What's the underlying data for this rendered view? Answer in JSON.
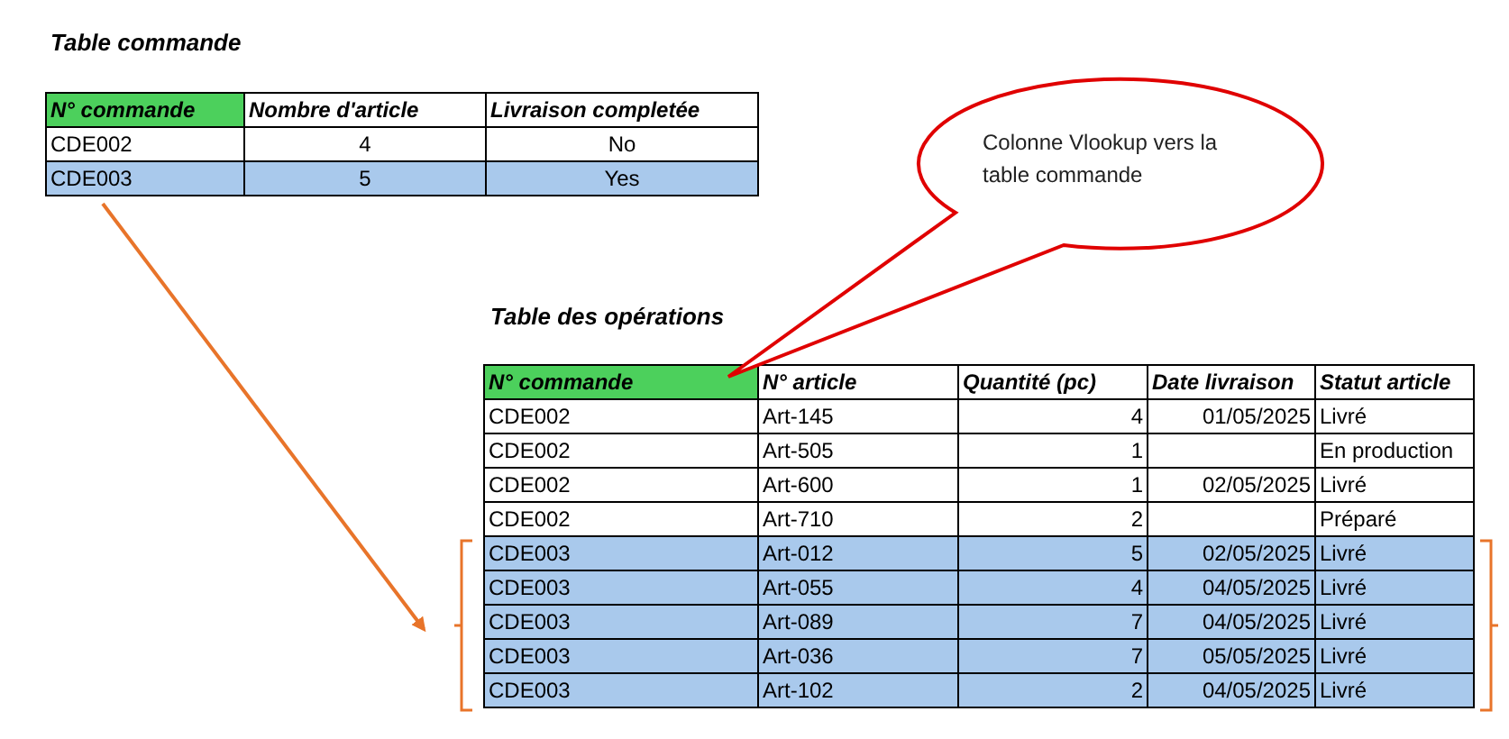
{
  "orders_table": {
    "title": "Table commande",
    "columns": [
      {
        "label": "N° commande",
        "highlighted": true,
        "kind": "text"
      },
      {
        "label": "Nombre d'article",
        "highlighted": false,
        "kind": "centered"
      },
      {
        "label": "Livraison completée",
        "highlighted": false,
        "kind": "centered"
      }
    ],
    "rows": [
      {
        "highlighted": false,
        "cells": [
          "CDE002",
          "4",
          "No"
        ]
      },
      {
        "highlighted": true,
        "cells": [
          "CDE003",
          "5",
          "Yes"
        ]
      }
    ]
  },
  "callout": {
    "text": "Colonne Vlookup vers la table commande"
  },
  "operations_table": {
    "title": "Table des opérations",
    "columns": [
      {
        "label": "N° commande",
        "highlighted": true,
        "kind": "text"
      },
      {
        "label": "N° article",
        "highlighted": false,
        "kind": "text"
      },
      {
        "label": "Quantité (pc)",
        "highlighted": false,
        "kind": "number"
      },
      {
        "label": "Date livraison",
        "highlighted": false,
        "kind": "number"
      },
      {
        "label": "Statut article",
        "highlighted": false,
        "kind": "text"
      }
    ],
    "rows": [
      {
        "highlighted": false,
        "cells": [
          "CDE002",
          "Art-145",
          "4",
          "01/05/2025",
          "Livré"
        ]
      },
      {
        "highlighted": false,
        "cells": [
          "CDE002",
          "Art-505",
          "1",
          "",
          "En production"
        ]
      },
      {
        "highlighted": false,
        "cells": [
          "CDE002",
          "Art-600",
          "1",
          "02/05/2025",
          "Livré"
        ]
      },
      {
        "highlighted": false,
        "cells": [
          "CDE002",
          "Art-710",
          "2",
          "",
          "Préparé"
        ]
      },
      {
        "highlighted": true,
        "cells": [
          "CDE003",
          "Art-012",
          "5",
          "02/05/2025",
          "Livré"
        ]
      },
      {
        "highlighted": true,
        "cells": [
          "CDE003",
          "Art-055",
          "4",
          "04/05/2025",
          "Livré"
        ]
      },
      {
        "highlighted": true,
        "cells": [
          "CDE003",
          "Art-089",
          "7",
          "04/05/2025",
          "Livré"
        ]
      },
      {
        "highlighted": true,
        "cells": [
          "CDE003",
          "Art-036",
          "7",
          "05/05/2025",
          "Livré"
        ]
      },
      {
        "highlighted": true,
        "cells": [
          "CDE003",
          "Art-102",
          "2",
          "04/05/2025",
          "Livré"
        ]
      }
    ]
  }
}
